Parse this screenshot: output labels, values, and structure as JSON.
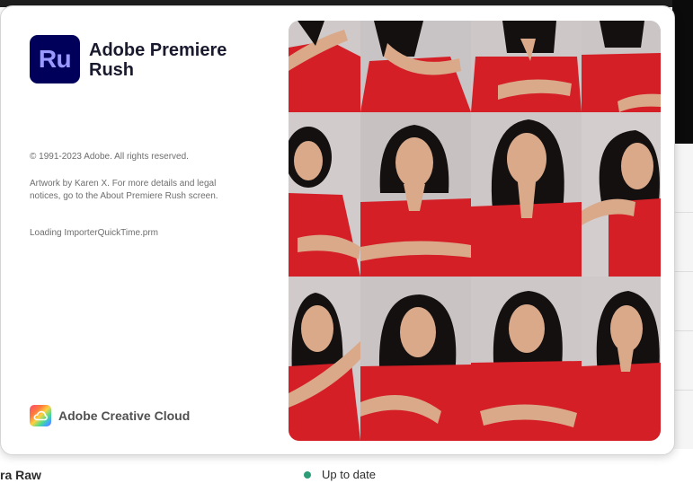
{
  "background_app": {
    "row_label": "ra Raw",
    "status_text": "Up to date",
    "status_color": "#2d9d78"
  },
  "splash": {
    "logo_text": "Ru",
    "logo_bg": "#00005b",
    "logo_fg": "#9999ff",
    "app_name_line1": "Adobe Premiere",
    "app_name_line2": "Rush",
    "copyright": "© 1991-2023 Adobe. All rights reserved.",
    "artwork_credit": "Artwork by Karen X. For more details and legal notices, go to the About Premiere Rush screen.",
    "loading_text": "Loading ImporterQuickTime.prm",
    "brand_icon": "creative-cloud-icon",
    "brand_text": "Adobe Creative Cloud"
  },
  "artwork": {
    "colors": {
      "shirt": "#d41f26",
      "hair": "#141010",
      "skin": "#d9a98a",
      "backdrop": "#c9c4c4"
    }
  }
}
